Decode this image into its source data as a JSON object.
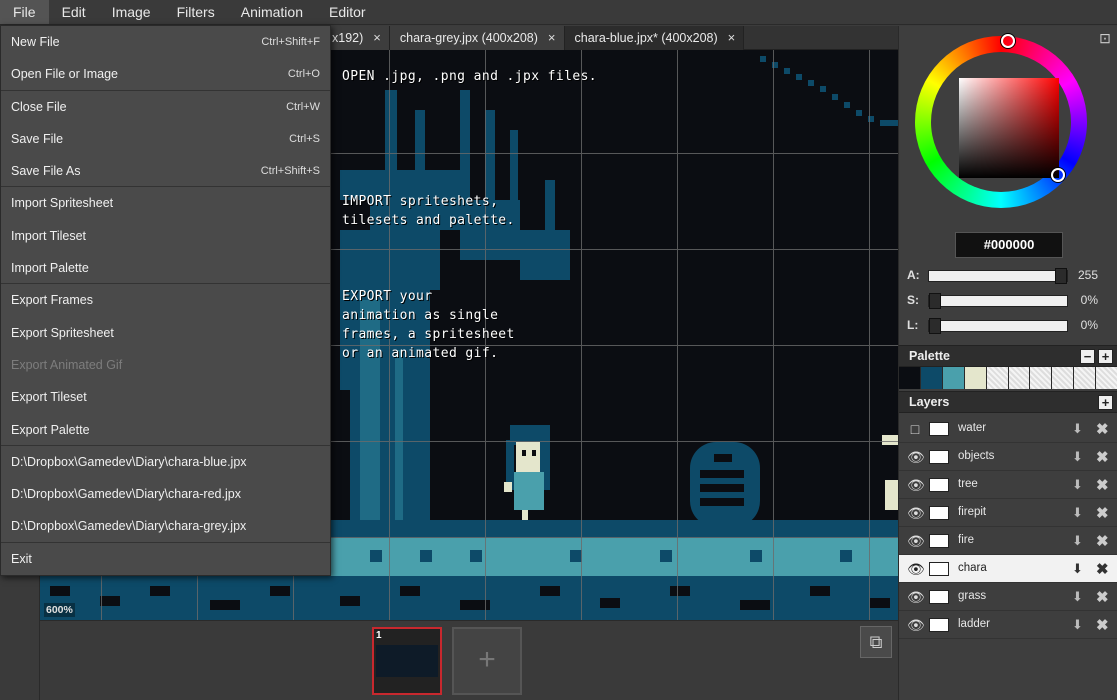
{
  "menubar": [
    "File",
    "Edit",
    "Image",
    "Filters",
    "Animation",
    "Editor"
  ],
  "tabs": [
    {
      "label": "x192)",
      "close": "×"
    },
    {
      "label": "chara-grey.jpx (400x208)",
      "close": "×"
    },
    {
      "label": "chara-blue.jpx* (400x208)",
      "close": "×"
    }
  ],
  "canvas": {
    "text1": "OPEN .jpg, .png and .jpx files.",
    "text2": "IMPORT spriteshets,\ntilesets and palette.",
    "text3": "EXPORT your\nanimation as single\nframes, a spritesheet\nor an animated gif.",
    "zoom": "600%"
  },
  "timeline": {
    "frame_number": "1",
    "add_frame": "+",
    "onion_icon": "⧉"
  },
  "color": {
    "hex": "#000000",
    "sliders": [
      {
        "label": "A:",
        "value": "255",
        "level": 1.0
      },
      {
        "label": "S:",
        "value": "0%",
        "level": 0.0
      },
      {
        "label": "L:",
        "value": "0%",
        "level": 0.0
      }
    ],
    "collapse": "⊡"
  },
  "palette": {
    "title": "Palette",
    "remove": "−",
    "add": "+",
    "colors": [
      "#0b0d12",
      "#0d4a68",
      "#4aa0ac",
      "#e4e6cc"
    ]
  },
  "layers": {
    "title": "Layers",
    "add": "+",
    "items": [
      {
        "name": "water",
        "visible": false
      },
      {
        "name": "objects",
        "visible": true
      },
      {
        "name": "tree",
        "visible": true
      },
      {
        "name": "firepit",
        "visible": true
      },
      {
        "name": "fire",
        "visible": true
      },
      {
        "name": "chara",
        "visible": true,
        "selected": true
      },
      {
        "name": "grass",
        "visible": true
      },
      {
        "name": "ladder",
        "visible": true
      }
    ]
  },
  "file_menu": [
    {
      "label": "New File",
      "shortcut": "Ctrl+Shift+F",
      "sep": false
    },
    {
      "label": "Open File or Image",
      "shortcut": "Ctrl+O",
      "sep": true
    },
    {
      "label": "Close File",
      "shortcut": "Ctrl+W",
      "sep": false
    },
    {
      "label": "Save File",
      "shortcut": "Ctrl+S",
      "sep": false
    },
    {
      "label": "Save File As",
      "shortcut": "Ctrl+Shift+S",
      "sep": true
    },
    {
      "label": "Import Spritesheet",
      "shortcut": "",
      "sep": false
    },
    {
      "label": "Import Tileset",
      "shortcut": "",
      "sep": false
    },
    {
      "label": "Import Palette",
      "shortcut": "",
      "sep": true
    },
    {
      "label": "Export Frames",
      "shortcut": "",
      "sep": false
    },
    {
      "label": "Export Spritesheet",
      "shortcut": "",
      "sep": false
    },
    {
      "label": "Export Animated Gif",
      "shortcut": "",
      "sep": false,
      "disabled": true
    },
    {
      "label": "Export Tileset",
      "shortcut": "",
      "sep": false
    },
    {
      "label": "Export Palette",
      "shortcut": "",
      "sep": true
    },
    {
      "label": "D:\\Dropbox\\Gamedev\\Diary\\chara-blue.jpx",
      "shortcut": "",
      "sep": false
    },
    {
      "label": "D:\\Dropbox\\Gamedev\\Diary\\chara-red.jpx",
      "shortcut": "",
      "sep": false
    },
    {
      "label": "D:\\Dropbox\\Gamedev\\Diary\\chara-grey.jpx",
      "shortcut": "",
      "sep": true
    },
    {
      "label": "Exit",
      "shortcut": "",
      "sep": false
    }
  ]
}
